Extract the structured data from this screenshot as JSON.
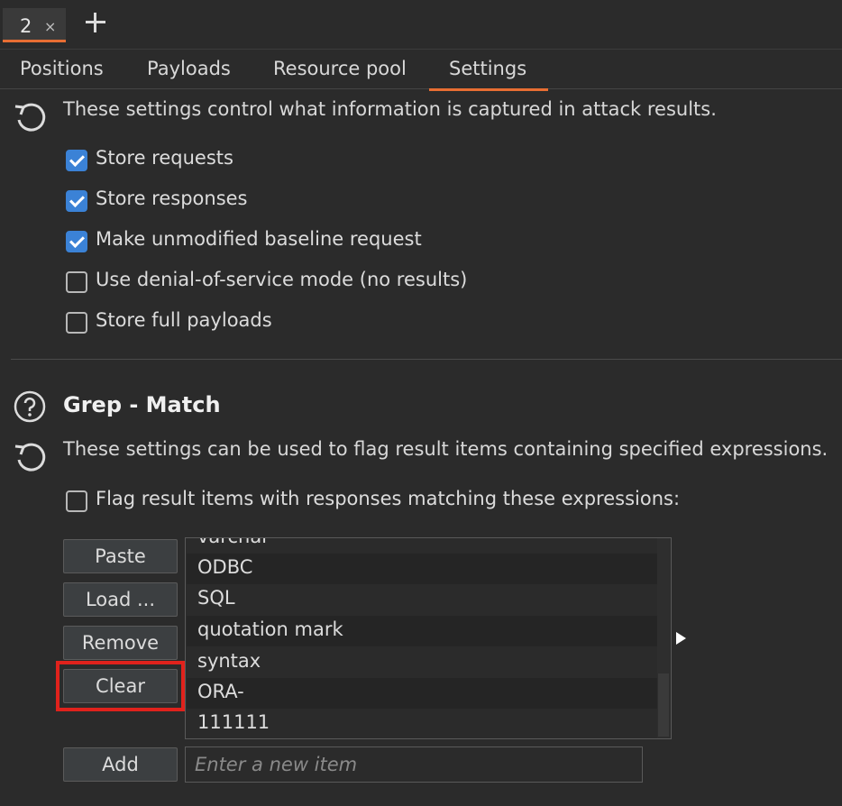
{
  "tab": {
    "number": "2",
    "close_glyph": "×",
    "add_icon": "plus-icon"
  },
  "subtabs": [
    "Positions",
    "Payloads",
    "Resource pool",
    "Settings"
  ],
  "active_subtab": "Settings",
  "results_section": {
    "description": "These settings control what information is captured in attack results.",
    "options": [
      {
        "label": "Store requests",
        "checked": true
      },
      {
        "label": "Store responses",
        "checked": true
      },
      {
        "label": "Make unmodified baseline request",
        "checked": true
      },
      {
        "label": "Use denial-of-service mode (no results)",
        "checked": false
      },
      {
        "label": "Store full payloads",
        "checked": false
      }
    ]
  },
  "grep_match": {
    "title": "Grep - Match",
    "description": "These settings can be used to flag result items containing specified expressions.",
    "flag_option": {
      "label": "Flag result items with responses matching these expressions:",
      "checked": false
    },
    "buttons": {
      "paste": "Paste",
      "load": "Load ...",
      "remove": "Remove",
      "clear": "Clear",
      "add": "Add"
    },
    "items": [
      "varchar",
      "ODBC",
      "SQL",
      "quotation mark",
      "syntax",
      "ORA-",
      "111111"
    ],
    "new_item_placeholder": "Enter a new item"
  },
  "colors": {
    "accent": "#e86e33",
    "checkbox": "#3b82d6",
    "highlight": "#e0221c",
    "background": "#2b2b2b"
  }
}
